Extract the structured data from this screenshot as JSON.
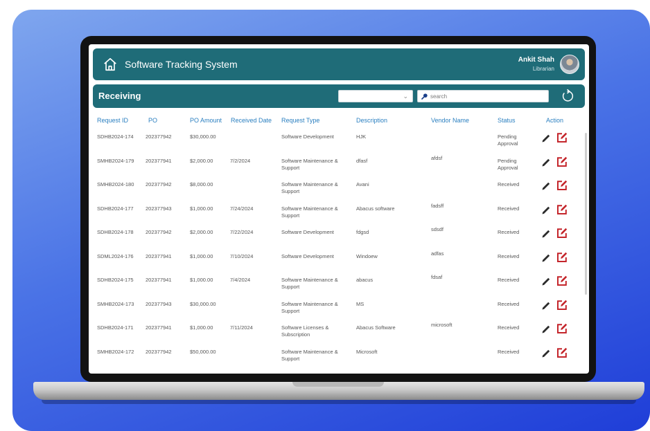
{
  "header": {
    "app_title": "Software Tracking System",
    "user_name": "Ankit Shah",
    "user_role": "Librarian"
  },
  "toolbar": {
    "section_title": "Receiving",
    "filter_value": "",
    "search_placeholder": "search"
  },
  "table": {
    "columns": [
      "Request ID",
      "PO",
      "PO Amount",
      "Received Date",
      "Request Type",
      "Description",
      "Vendor Name",
      "Status",
      "Action"
    ],
    "rows": [
      {
        "request_id": "SDHB2024-174",
        "po": "202377942",
        "amount": "$30,000.00",
        "date": "",
        "type": "Software Development",
        "description": "HJK",
        "vendor": "",
        "status": "Pending Approval"
      },
      {
        "request_id": "SMHB2024-179",
        "po": "202377941",
        "amount": "$2,000.00",
        "date": "7/2/2024",
        "type": "Software Maintenance & Support",
        "description": "dfasf",
        "vendor": "afdsf",
        "status": "Pending Approval"
      },
      {
        "request_id": "SMHB2024-180",
        "po": "202377942",
        "amount": "$8,000.00",
        "date": "",
        "type": "Software Maintenance & Support",
        "description": "Avani",
        "vendor": "",
        "status": "Received"
      },
      {
        "request_id": "SDHB2024-177",
        "po": "202377943",
        "amount": "$1,000.00",
        "date": "7/24/2024",
        "type": "Software Maintenance & Support",
        "description": "Abacus software",
        "vendor": "fadsff",
        "status": "Received"
      },
      {
        "request_id": "SDHB2024-178",
        "po": "202377942",
        "amount": "$2,000.00",
        "date": "7/22/2024",
        "type": "Software Development",
        "description": "fdgsd",
        "vendor": "sdsdf",
        "status": "Received"
      },
      {
        "request_id": "SDML2024-176",
        "po": "202377941",
        "amount": "$1,000.00",
        "date": "7/10/2024",
        "type": "Software Development",
        "description": "Windoew",
        "vendor": "adfas",
        "status": "Received"
      },
      {
        "request_id": "SDHB2024-175",
        "po": "202377941",
        "amount": "$1,000.00",
        "date": "7/4/2024",
        "type": "Software Maintenance & Support",
        "description": "abacus",
        "vendor": "fdsaf",
        "status": "Received"
      },
      {
        "request_id": "SMHB2024-173",
        "po": "202377943",
        "amount": "$30,000.00",
        "date": "",
        "type": "Software Maintenance & Support",
        "description": "MS",
        "vendor": "",
        "status": "Received"
      },
      {
        "request_id": "SDHB2024-171",
        "po": "202377941",
        "amount": "$1,000.00",
        "date": "7/11/2024",
        "type": "Software Licenses & Subscription",
        "description": "Abacus Software",
        "vendor": "microsoft",
        "status": "Received"
      },
      {
        "request_id": "SMHB2024-172",
        "po": "202377942",
        "amount": "$50,000.00",
        "date": "",
        "type": "Software Maintenance & Support",
        "description": "Microsoft",
        "vendor": "",
        "status": "Received"
      }
    ]
  },
  "colors": {
    "brand_teal": "#1f6c78",
    "header_text": "#2a7fc0",
    "edit_red": "#c4252b"
  },
  "icons": {
    "home": "home-icon",
    "search": "search-icon",
    "refresh": "refresh-icon",
    "pencil": "pencil-icon",
    "edit": "edit-icon"
  }
}
